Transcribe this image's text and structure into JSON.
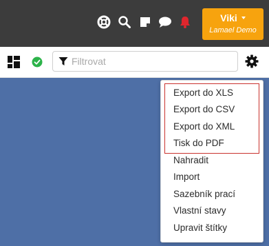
{
  "header": {
    "icons": [
      "lifebuoy-icon",
      "search-icon",
      "note-icon",
      "chat-icon",
      "bell-icon"
    ],
    "user": {
      "name": "Viki",
      "subtitle": "Lamael Demo"
    },
    "colors": {
      "bar": "#3c3c3c",
      "user_button": "#f7a30e",
      "bell": "#e0262d"
    }
  },
  "toolbar": {
    "filter_placeholder": "Filtrovat",
    "status_color": "#2cb34a"
  },
  "menu": {
    "export_items": [
      {
        "label": "Export do XLS"
      },
      {
        "label": "Export do CSV"
      },
      {
        "label": "Export do XML"
      },
      {
        "label": "Tisk do PDF"
      }
    ],
    "items": [
      {
        "label": "Nahradit"
      },
      {
        "label": "Import"
      },
      {
        "label": "Sazebník prací"
      },
      {
        "label": "Vlastní stavy"
      },
      {
        "label": "Upravit štítky"
      }
    ],
    "highlight_color": "#c9302c"
  }
}
